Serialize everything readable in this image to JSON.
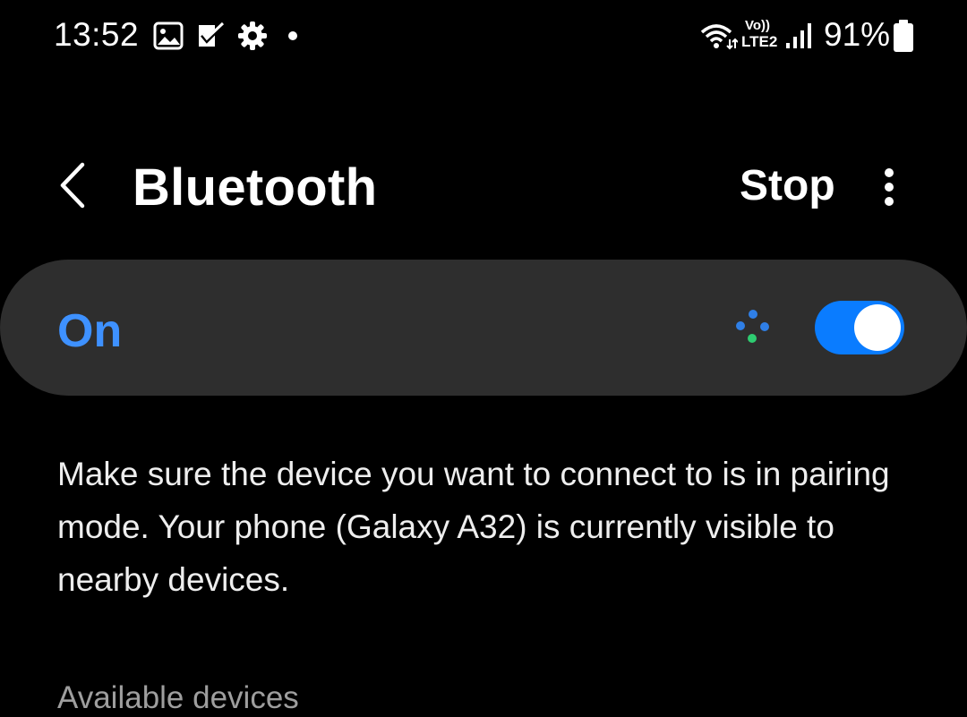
{
  "status_bar": {
    "time": "13:52",
    "notification_icons": [
      "gallery-icon",
      "task-check-icon",
      "settings-gear-icon",
      "dot-more-icon"
    ],
    "right_icons": [
      "wifi-icon",
      "volte-lte2-icon",
      "signal-icon",
      "battery-icon"
    ],
    "volte_label": "Vo))",
    "lte_label": "LTE2",
    "battery_percent": "91%"
  },
  "header": {
    "title": "Bluetooth",
    "stop_label": "Stop",
    "back_icon": "chevron-left-icon",
    "more_icon": "more-vertical-icon"
  },
  "toggle_card": {
    "label": "On",
    "state": true,
    "scan_icon": "scanning-dots-icon"
  },
  "description": "Make sure the device you want to connect to is in pairing mode. Your phone (Galaxy A32) is currently visible to nearby devices.",
  "available_section": {
    "title": "Available devices"
  },
  "colors": {
    "background": "#000000",
    "card": "#2e2e2e",
    "accent": "#3e91ff",
    "toggle_on": "#0a7cff",
    "scan_green": "#2ecc71",
    "section_header": "#9e9e9e"
  }
}
